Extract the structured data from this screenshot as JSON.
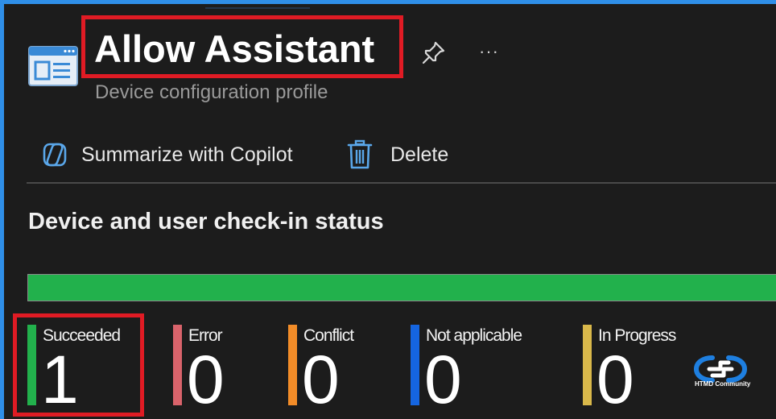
{
  "header": {
    "title": "Allow Assistant",
    "subtitle": "Device configuration profile",
    "more_label": "···"
  },
  "toolbar": {
    "copilot_label": "Summarize with Copilot",
    "delete_label": "Delete"
  },
  "status": {
    "section_title": "Device and user check-in status",
    "progress_succeeded_fraction": 1.0,
    "colors": {
      "succeeded": "#22b14c",
      "error": "#d9636b",
      "conflict": "#f28c28",
      "not_applicable": "#1565e0",
      "in_progress": "#d9b84a",
      "highlight": "#e01b24",
      "accent": "#2f8fe8"
    },
    "items": [
      {
        "label": "Succeeded",
        "value": "1"
      },
      {
        "label": "Error",
        "value": "0"
      },
      {
        "label": "Conflict",
        "value": "0"
      },
      {
        "label": "Not applicable",
        "value": "0"
      },
      {
        "label": "In Progress",
        "value": "0"
      }
    ]
  },
  "watermark": {
    "text": "HTMD Community"
  },
  "icons": [
    "profile-icon",
    "pin-icon",
    "more-icon",
    "copilot-icon",
    "trash-icon",
    "htmd-logo"
  ]
}
